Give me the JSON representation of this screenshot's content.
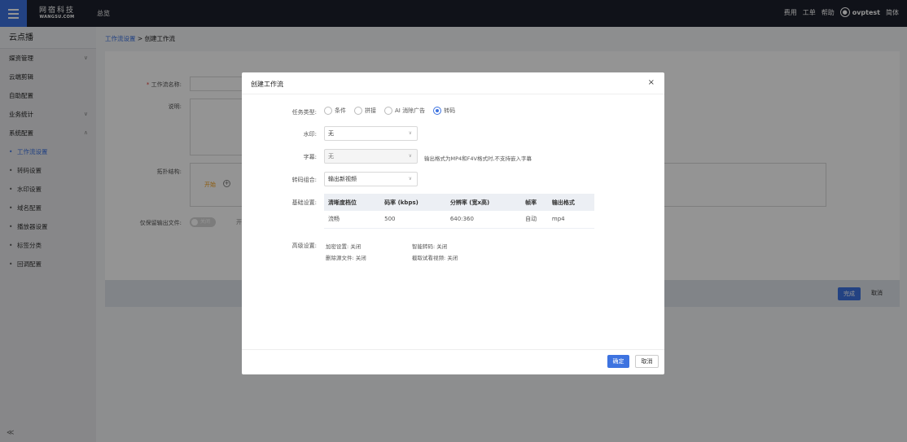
{
  "topbar": {
    "logo_cn": "网宿科技",
    "logo_en": "WANGSU.COM",
    "overview": "总览",
    "links": [
      "费用",
      "工单",
      "帮助"
    ],
    "user_icon": "user-icon",
    "username": "ovptest",
    "language": "简体"
  },
  "sidebar": {
    "title": "云点播",
    "items": [
      {
        "label": "媒资管理",
        "chevron": "∨"
      },
      {
        "label": "云端剪辑",
        "chevron": ""
      },
      {
        "label": "自助配置",
        "chevron": ""
      },
      {
        "label": "业务统计",
        "chevron": "∨"
      },
      {
        "label": "系统配置",
        "chevron": "∧"
      }
    ],
    "sub_items": [
      "工作流设置",
      "转码设置",
      "水印设置",
      "域名配置",
      "播放器设置",
      "标签分类",
      "回调配置"
    ],
    "collapse": "≪"
  },
  "breadcrumb": {
    "parent": "工作流设置",
    "separator": " > ",
    "current": "创建工作流"
  },
  "form": {
    "name_star": "*",
    "name_label": "工作流名称:",
    "desc_label": "说明:",
    "structure_label": "拓扑结构:",
    "start": "开始",
    "plus": "+",
    "keep_output_label": "仅保留输出文件:",
    "toggle_text": "关闭",
    "toggle_after": "开"
  },
  "footer": {
    "finish": "完成",
    "cancel": "取消"
  },
  "modal": {
    "title": "创建工作流",
    "close": "×",
    "task_type_label": "任务类型:",
    "task_types": [
      {
        "label": "条件",
        "checked": false
      },
      {
        "label": "拼接",
        "checked": false
      },
      {
        "label": "AI 消除广告",
        "checked": false
      },
      {
        "label": "转码",
        "checked": true
      }
    ],
    "watermark_label": "水印:",
    "watermark_value": "无",
    "subtitle_label": "字幕:",
    "subtitle_value": "无",
    "subtitle_hint": "输出格式为MP4和F4V格式时,不支持嵌入字幕",
    "transcode_combo_label": "转码组合:",
    "transcode_combo_value": "输出新视频",
    "basic_label": "基础设置:",
    "table": {
      "headers": [
        "清晰度档位",
        "码率 (kbps)",
        "分辨率 (宽x高)",
        "帧率",
        "输出格式"
      ],
      "rows": [
        [
          "流畅",
          "500",
          "640:360",
          "自动",
          "mp4"
        ]
      ]
    },
    "advanced_label": "高级设置:",
    "advanced": {
      "encrypt": "加密设置: 关闭",
      "smart": "智能转码: 关闭",
      "delete_source": "删除源文件: 关闭",
      "preview_clip": "截取试看视频: 关闭"
    },
    "ok": "确定",
    "cancel": "取消"
  },
  "colors": {
    "accent": "#3d73e0",
    "topbar": "#1c1f2b"
  }
}
